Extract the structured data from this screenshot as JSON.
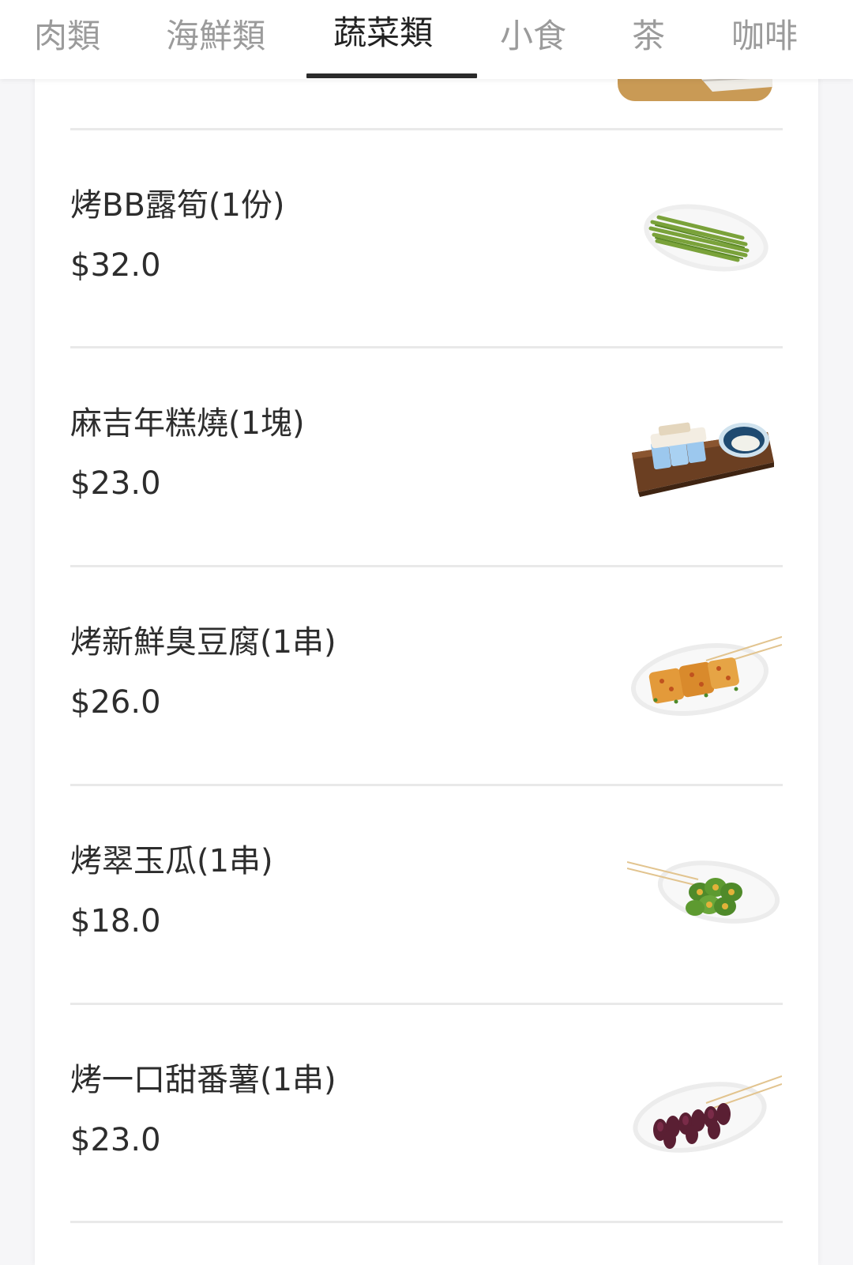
{
  "tabs": [
    {
      "label": "肉類",
      "active": false
    },
    {
      "label": "海鮮類",
      "active": false
    },
    {
      "label": "蔬菜類",
      "active": true
    },
    {
      "label": "小食",
      "active": false
    },
    {
      "label": "茶",
      "active": false
    },
    {
      "label": "咖啡",
      "active": false
    }
  ],
  "menu": {
    "items": [
      {
        "name": "烤BB露筍(1份)",
        "price": "$32.0",
        "photo": "grilled-asparagus-photo"
      },
      {
        "name": "麻吉年糕燒(1塊)",
        "price": "$23.0",
        "photo": "mochi-rice-cake-photo"
      },
      {
        "name": "烤新鮮臭豆腐(1串)",
        "price": "$26.0",
        "photo": "stinky-tofu-skewer-photo"
      },
      {
        "name": "烤翠玉瓜(1串)",
        "price": "$18.0",
        "photo": "zucchini-skewer-photo"
      },
      {
        "name": "烤一口甜番薯(1串)",
        "price": "$23.0",
        "photo": "sweet-potato-skewer-photo"
      }
    ]
  },
  "colors": {
    "active_tab": "#222222",
    "inactive_tab": "#9b9b9b",
    "text": "#2d2d2d",
    "divider": "#e9e9e9",
    "page_bg": "#f6f6f8"
  }
}
